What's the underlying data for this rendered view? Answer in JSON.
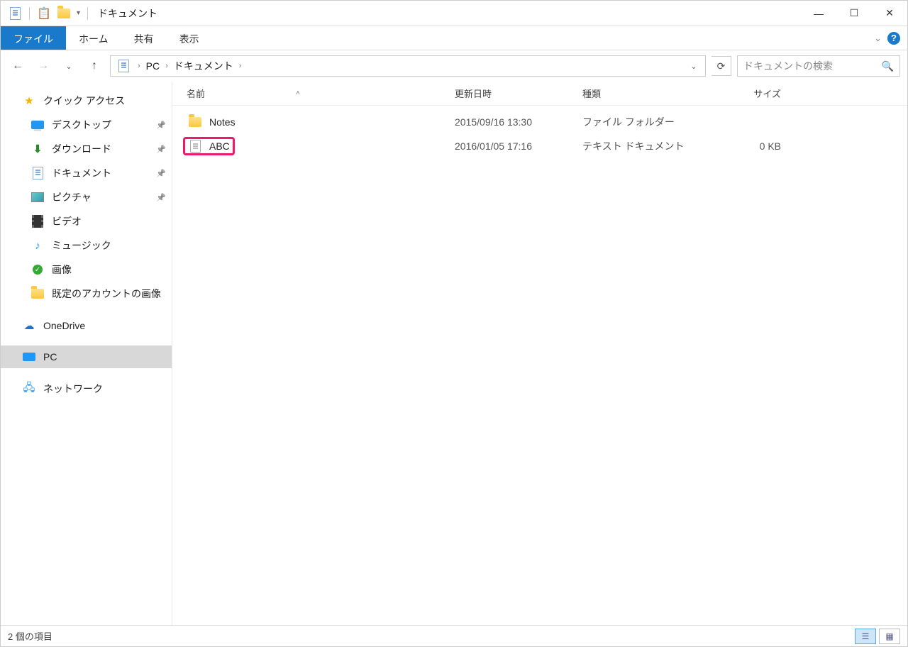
{
  "title": "ドキュメント",
  "ribbon": {
    "file": "ファイル",
    "home": "ホーム",
    "share": "共有",
    "view": "表示"
  },
  "breadcrumb": {
    "seg1": "PC",
    "seg2": "ドキュメント"
  },
  "search": {
    "placeholder": "ドキュメントの検索"
  },
  "sidebar": {
    "items": {
      "0": {
        "label": "クイック アクセス"
      },
      "1": {
        "label": "デスクトップ"
      },
      "2": {
        "label": "ダウンロード"
      },
      "3": {
        "label": "ドキュメント"
      },
      "4": {
        "label": "ピクチャ"
      },
      "5": {
        "label": "ビデオ"
      },
      "6": {
        "label": "ミュージック"
      },
      "7": {
        "label": "画像"
      },
      "8": {
        "label": "既定のアカウントの画像"
      },
      "9": {
        "label": "OneDrive"
      },
      "10": {
        "label": "PC"
      },
      "11": {
        "label": "ネットワーク"
      }
    }
  },
  "columns": {
    "name": "名前",
    "date": "更新日時",
    "type": "種類",
    "size": "サイズ"
  },
  "files": {
    "0": {
      "name": "Notes",
      "date": "2015/09/16 13:30",
      "type": "ファイル フォルダー",
      "size": ""
    },
    "1": {
      "name": "ABC",
      "date": "2016/01/05 17:16",
      "type": "テキスト ドキュメント",
      "size": "0 KB"
    }
  },
  "status": {
    "text": "2 個の項目"
  }
}
